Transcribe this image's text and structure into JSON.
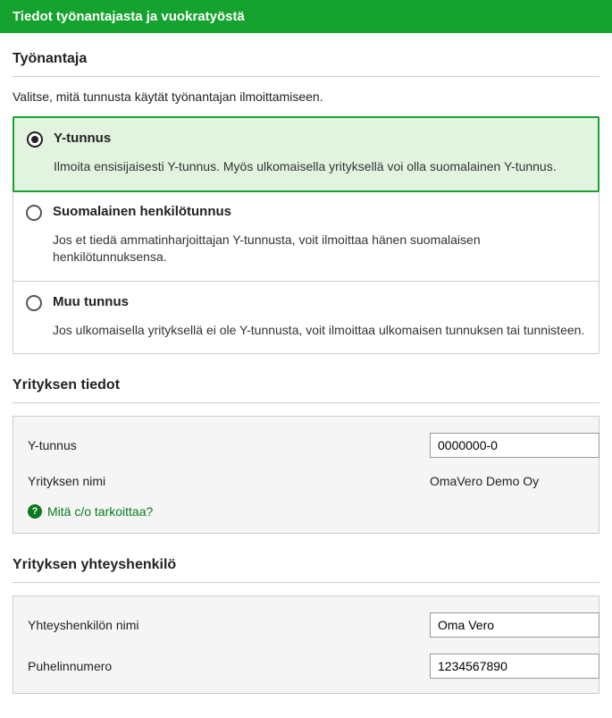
{
  "header": {
    "title": "Tiedot työnantajasta ja vuokratyöstä"
  },
  "employer": {
    "section_title": "Työnantaja",
    "instruction": "Valitse, mitä tunnusta käytät työnantajan ilmoittamiseen.",
    "options": [
      {
        "label": "Y-tunnus",
        "desc": "Ilmoita ensisijaisesti Y-tunnus. Myös ulkomaisella yrityksellä voi olla suomalainen Y-tunnus.",
        "selected": true
      },
      {
        "label": "Suomalainen henkilötunnus",
        "desc": "Jos et tiedä ammatinharjoittajan Y-tunnusta, voit ilmoittaa hänen suomalaisen henkilötunnuksensa.",
        "selected": false
      },
      {
        "label": "Muu tunnus",
        "desc": "Jos ulkomaisella yrityksellä ei ole Y-tunnusta, voit ilmoittaa ulkomaisen tunnuksen tai tunnisteen.",
        "selected": false
      }
    ]
  },
  "company": {
    "section_title": "Yrityksen tiedot",
    "ytunnus_label": "Y-tunnus",
    "ytunnus_value": "0000000-0",
    "name_label": "Yrityksen nimi",
    "name_value": "OmaVero Demo Oy",
    "help_link": "Mitä c/o tarkoittaa?"
  },
  "contact": {
    "section_title": "Yrityksen yhteyshenkilö",
    "name_label": "Yhteyshenkilön nimi",
    "name_value": "Oma Vero",
    "phone_label": "Puhelinnumero",
    "phone_value": "1234567890"
  }
}
